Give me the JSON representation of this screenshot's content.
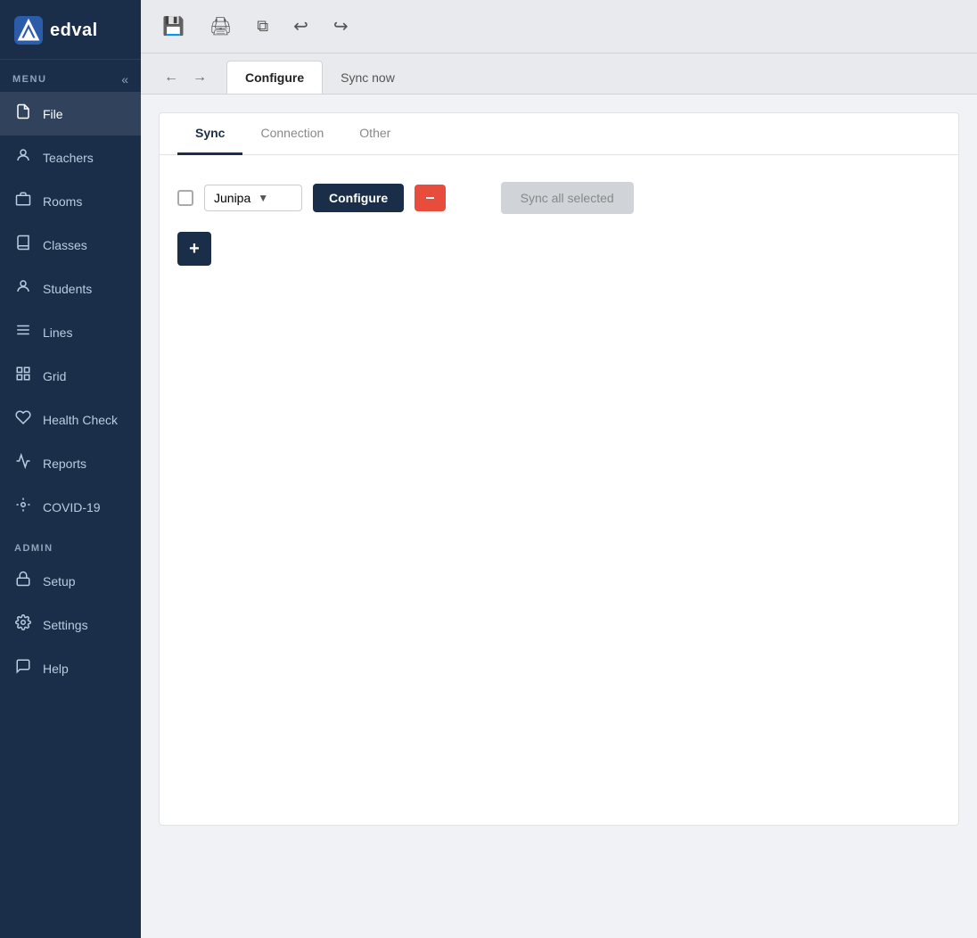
{
  "brand": {
    "logo_text": "edval"
  },
  "sidebar": {
    "menu_label": "MENU",
    "collapse_icon": "«",
    "items": [
      {
        "id": "file",
        "label": "File",
        "icon": "📁",
        "active": true
      },
      {
        "id": "teachers",
        "label": "Teachers",
        "icon": "👤",
        "active": false
      },
      {
        "id": "rooms",
        "label": "Rooms",
        "icon": "👤",
        "active": false
      },
      {
        "id": "classes",
        "label": "Classes",
        "icon": "📖",
        "active": false
      },
      {
        "id": "students",
        "label": "Students",
        "icon": "👤",
        "active": false
      },
      {
        "id": "lines",
        "label": "Lines",
        "icon": "☰",
        "active": false
      },
      {
        "id": "grid",
        "label": "Grid",
        "icon": "⊞",
        "active": false
      },
      {
        "id": "health-check",
        "label": "Health Check",
        "icon": "❤",
        "active": false
      },
      {
        "id": "reports",
        "label": "Reports",
        "icon": "📈",
        "active": false
      },
      {
        "id": "covid19",
        "label": "COVID-19",
        "icon": "⚙",
        "active": false
      }
    ],
    "admin_label": "ADMIN",
    "admin_items": [
      {
        "id": "setup",
        "label": "Setup",
        "icon": "🔒",
        "active": false
      },
      {
        "id": "settings",
        "label": "Settings",
        "icon": "⚙",
        "active": false
      },
      {
        "id": "help",
        "label": "Help",
        "icon": "💬",
        "active": false
      }
    ]
  },
  "toolbar": {
    "icons": [
      {
        "id": "save",
        "symbol": "💾"
      },
      {
        "id": "print",
        "symbol": "🖨"
      },
      {
        "id": "copy",
        "symbol": "📋"
      },
      {
        "id": "undo",
        "symbol": "↩"
      },
      {
        "id": "redo",
        "symbol": "↪"
      }
    ]
  },
  "page_tabs": [
    {
      "id": "configure",
      "label": "Configure",
      "active": true
    },
    {
      "id": "sync-now",
      "label": "Sync now",
      "active": false
    }
  ],
  "inner_tabs": [
    {
      "id": "sync",
      "label": "Sync",
      "active": true
    },
    {
      "id": "connection",
      "label": "Connection",
      "active": false
    },
    {
      "id": "other",
      "label": "Other",
      "active": false
    }
  ],
  "sync": {
    "dropdown_value": "Junipa",
    "configure_label": "Configure",
    "minus_symbol": "−",
    "sync_all_label": "Sync all selected",
    "add_symbol": "+"
  }
}
